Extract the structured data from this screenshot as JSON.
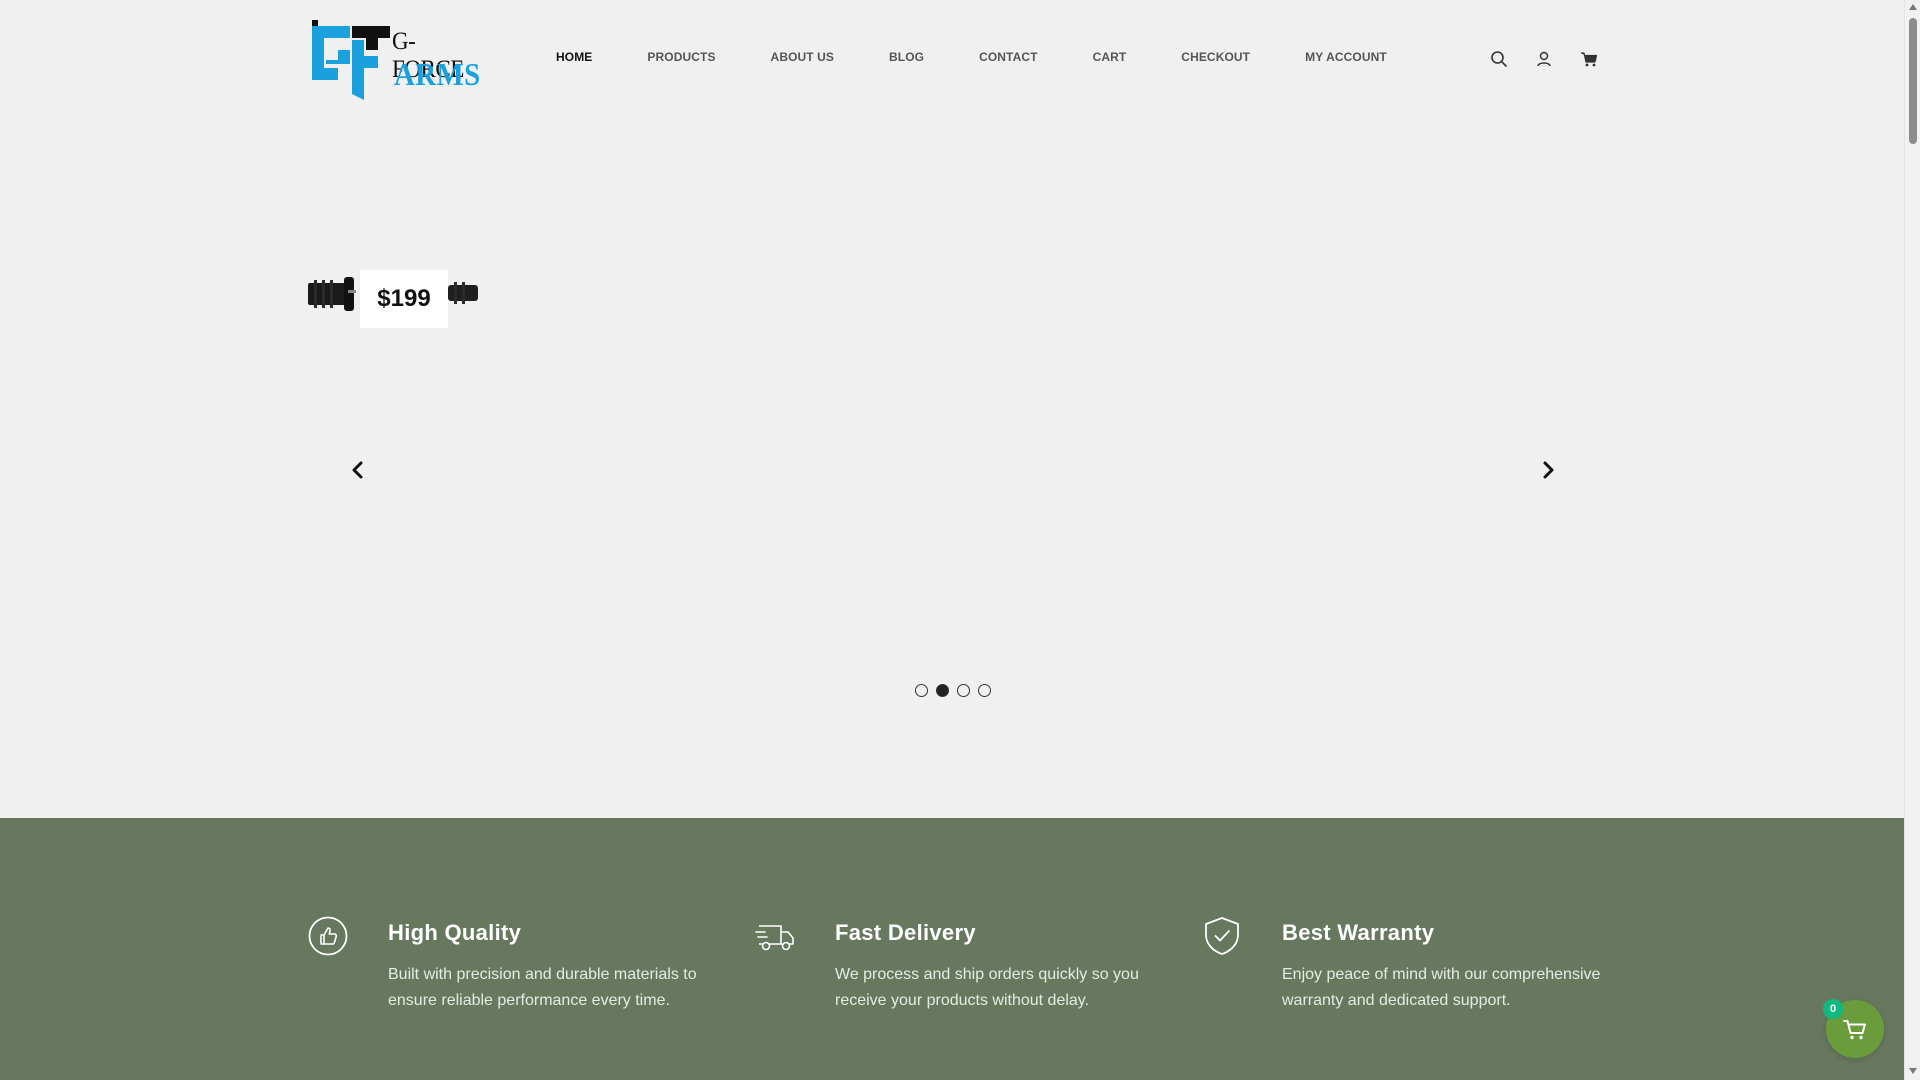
{
  "brand": {
    "line1": "G-FORCE",
    "line2": "ARMS",
    "accent_color": "#1aa0dc"
  },
  "nav": {
    "items": [
      {
        "label": "HOME",
        "active": true
      },
      {
        "label": "PRODUCTS"
      },
      {
        "label": "ABOUT US"
      },
      {
        "label": "BLOG"
      },
      {
        "label": "CONTACT"
      },
      {
        "label": "CART"
      },
      {
        "label": "CHECKOUT"
      },
      {
        "label": "MY ACCOUNT"
      }
    ]
  },
  "header_icons": [
    "search-icon",
    "user-icon",
    "cart-icon"
  ],
  "hero": {
    "price": "$199",
    "slides_count": 4,
    "active_slide": 2,
    "prev_icon": "chevron-left-icon",
    "next_icon": "chevron-right-icon"
  },
  "features": {
    "background_color": "#67785f",
    "items": [
      {
        "icon": "thumbs-up-icon",
        "title": "High Quality",
        "description": "Built with precision and durable materials to ensure reliable performance every time."
      },
      {
        "icon": "delivery-truck-icon",
        "title": "Fast Delivery",
        "description": "We process and ship orders quickly so you receive your products without delay."
      },
      {
        "icon": "shield-check-icon",
        "title": "Best Warranty",
        "description": "Enjoy peace of mind with our comprehensive warranty and dedicated support."
      }
    ]
  },
  "floating_cart": {
    "count": "0",
    "color": "#6a9c3c",
    "badge_color": "#10b981"
  }
}
